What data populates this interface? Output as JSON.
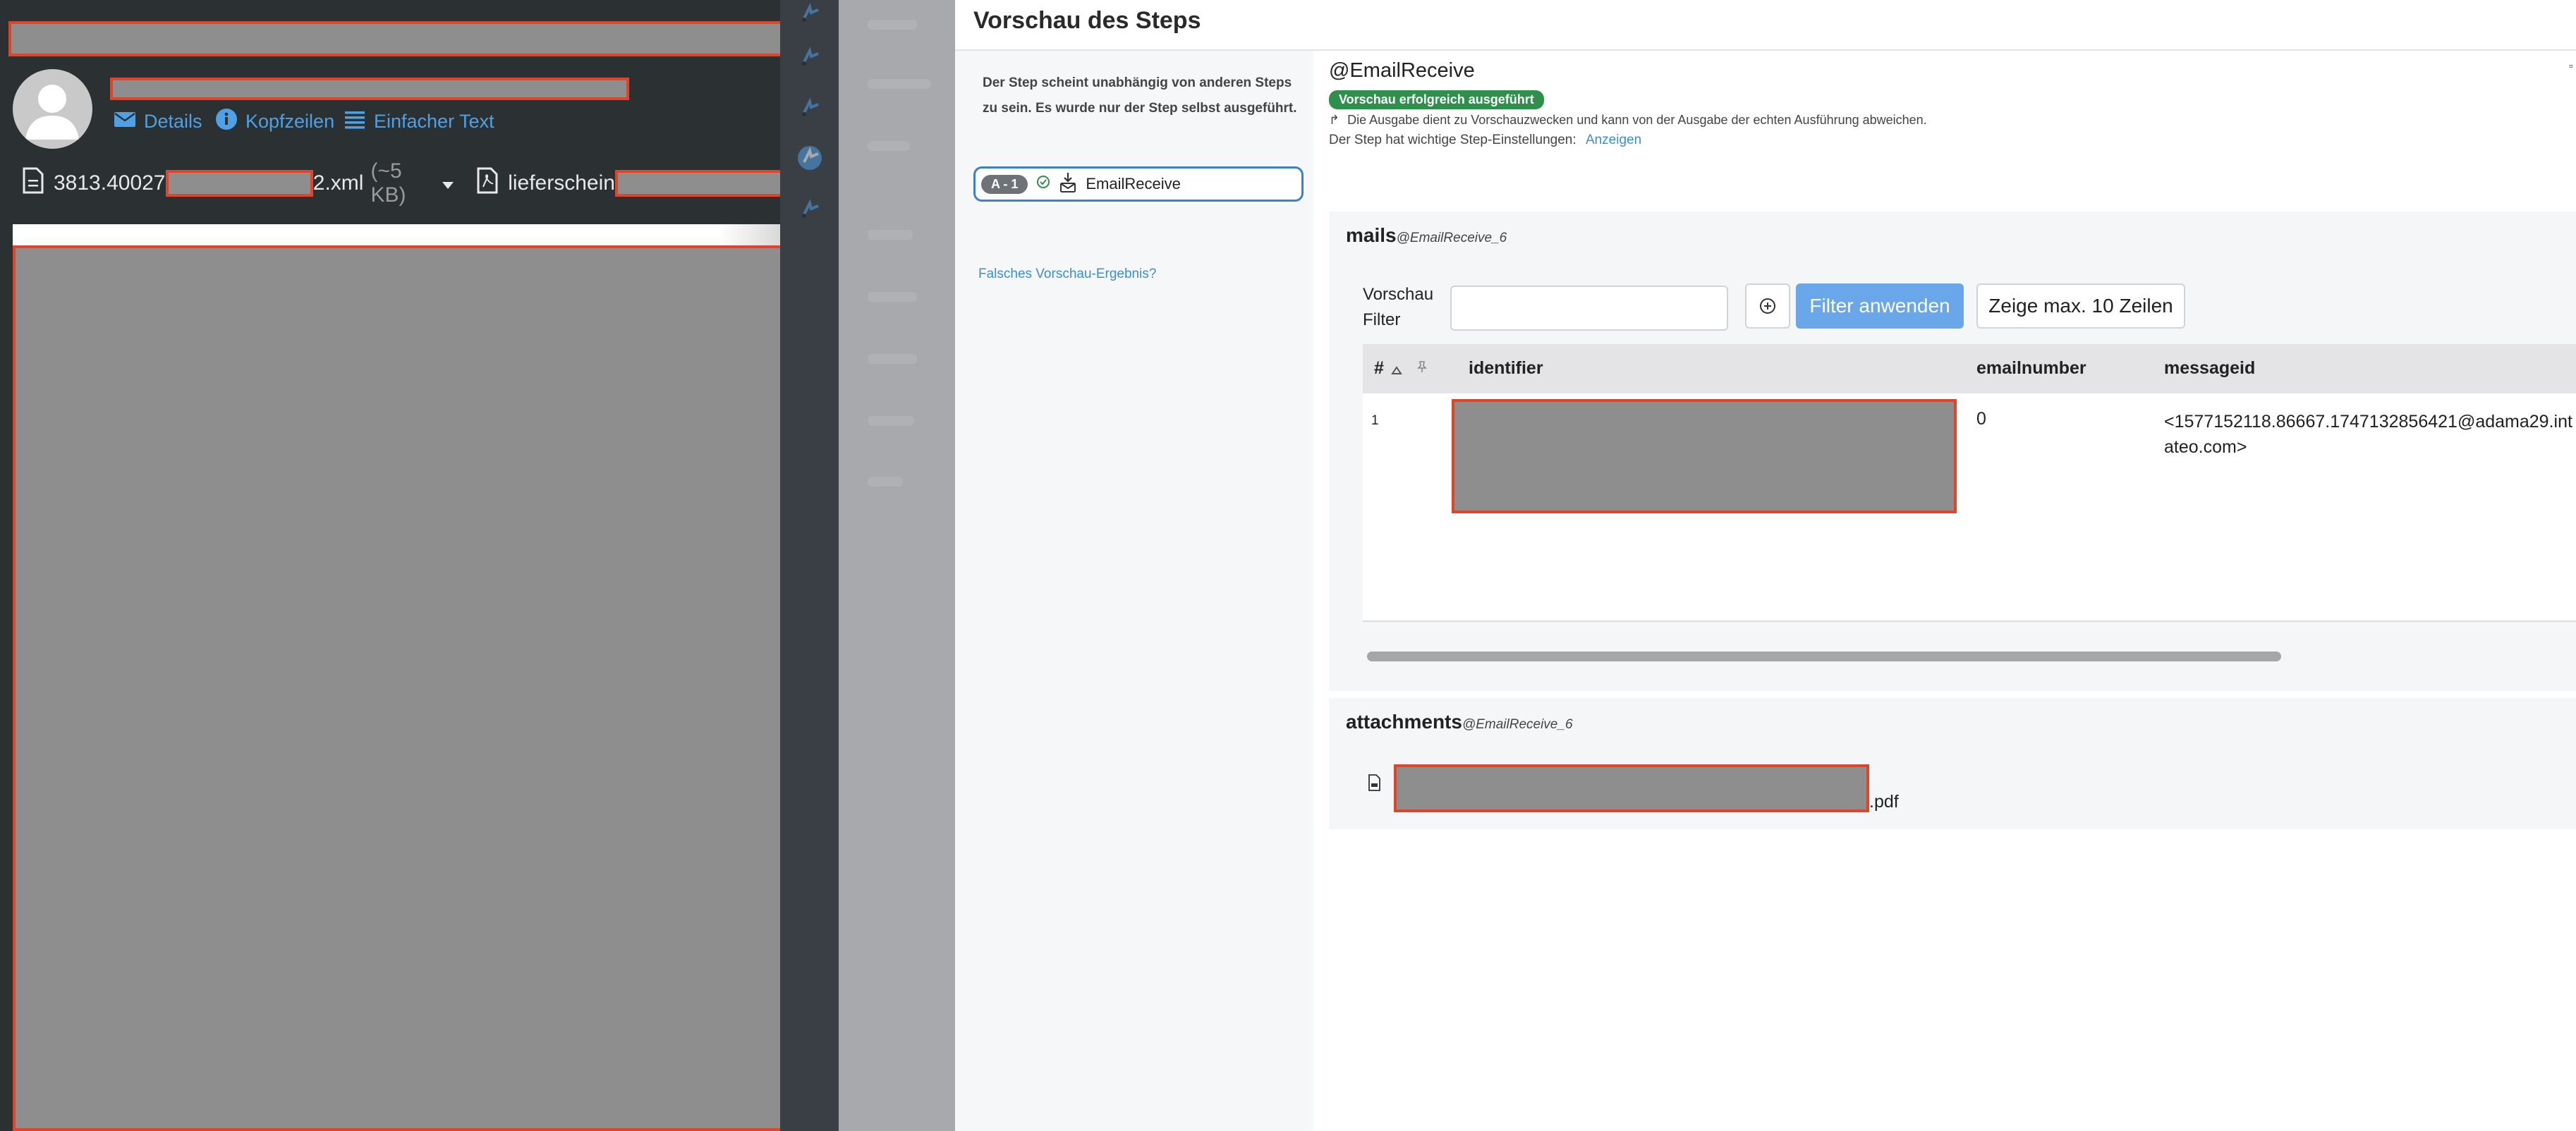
{
  "mail": {
    "links": {
      "details": "Details",
      "headers": "Kopfzeilen",
      "plain_text": "Einfacher Text"
    },
    "attachments": [
      {
        "name_start": "3813.40027",
        "name_end": "2.xml",
        "size": "(~5 KB)"
      },
      {
        "name_start": "lieferschein",
        "name_end": ""
      }
    ]
  },
  "modal": {
    "title": "Vorschau des Steps",
    "step_info": "Der Step scheint unabhängig von anderen Steps zu sein. Es wurde nur der Step selbst ausgeführt.",
    "step_item": {
      "badge": "A - 1",
      "name": "EmailReceive"
    },
    "wrong_result_link": "Falsches Vorschau-Ergebnis?",
    "step_name": "@EmailReceive",
    "success_badge": "Vorschau erfolgreich ausgeführt",
    "note": "Die Ausgabe dient zu Vorschauzwecken und kann von der Ausgabe der echten Ausführung abweichen.",
    "settings_text": "Der Step hat wichtige Step-Einstellungen:",
    "settings_link": "Anzeigen",
    "mails": {
      "title": "mails",
      "subtitle": "@EmailReceive_6",
      "filter_label": "Vorschau Filter",
      "filter_value": "",
      "apply_button": "Filter anwenden",
      "rows_button": "Zeige max. 10 Zeilen",
      "columns": [
        "#",
        "identifier",
        "emailnumber",
        "messageid"
      ],
      "rows": [
        {
          "index": "1",
          "emailnumber": "0",
          "messageid": "<1577152118.86667.1747132856421@adama29.int ateo.com>"
        }
      ]
    },
    "attachments": {
      "title": "attachments",
      "subtitle": "@EmailReceive_6",
      "file_suffix": ".pdf"
    }
  },
  "colors": {
    "accent": "#3b8ed6",
    "success": "#2f8f4c",
    "redaction_border": "#e0452b",
    "dark_bg": "#2b3033"
  }
}
